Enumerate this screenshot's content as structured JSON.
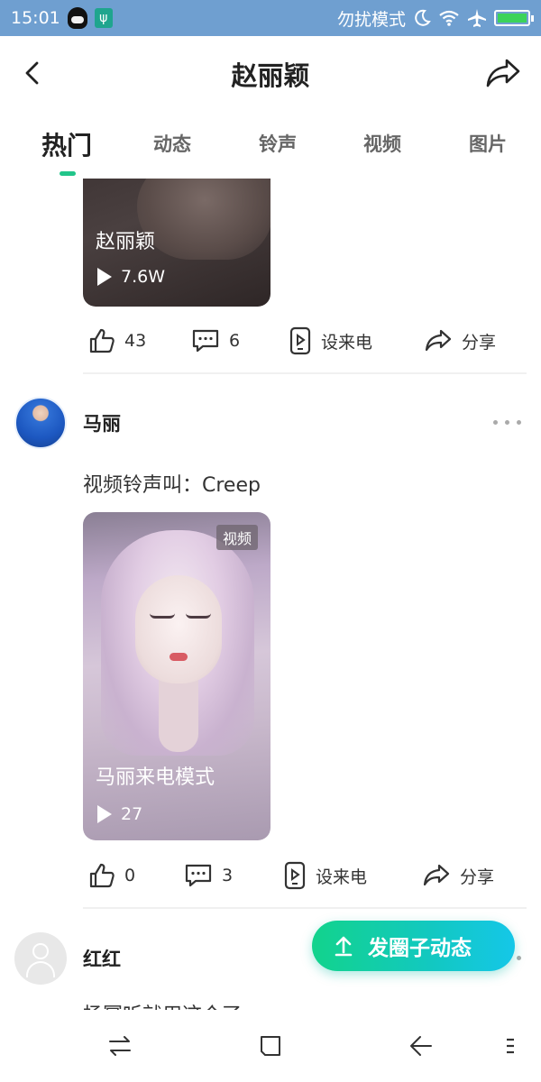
{
  "status_bar": {
    "time": "15:01",
    "dnd_text": "勿扰模式",
    "icons": [
      "qq-icon",
      "usb-icon",
      "moon-icon",
      "wifi-icon",
      "airplane-icon",
      "battery-icon"
    ]
  },
  "header": {
    "title": "赵丽颖",
    "back_icon": "chevron-left-icon",
    "share_icon": "share-icon"
  },
  "tabs": [
    {
      "label": "热门",
      "active": true
    },
    {
      "label": "动态",
      "active": false
    },
    {
      "label": "铃声",
      "active": false
    },
    {
      "label": "视频",
      "active": false
    },
    {
      "label": "图片",
      "active": false
    }
  ],
  "accent_color": "#22c58a",
  "posts": [
    {
      "thumb_title": "赵丽颖",
      "plays": "7.6W",
      "likes": "43",
      "comments": "6",
      "set_ring_label": "设来电",
      "share_label": "分享"
    },
    {
      "username": "马丽",
      "text": "视频铃声叫：Creep",
      "badge": "视频",
      "thumb_title": "马丽来电模式",
      "plays": "27",
      "likes": "0",
      "comments": "3",
      "set_ring_label": "设来电",
      "share_label": "分享"
    },
    {
      "username": "红红",
      "text": "杨幂听就用这个了"
    }
  ],
  "fab": {
    "label": "发圈子动态",
    "icon": "upload-arrow-icon"
  },
  "nav_bar": {
    "icons": [
      "switch-icon",
      "home-square-icon",
      "back-arrow-icon",
      "menu-icon"
    ]
  }
}
